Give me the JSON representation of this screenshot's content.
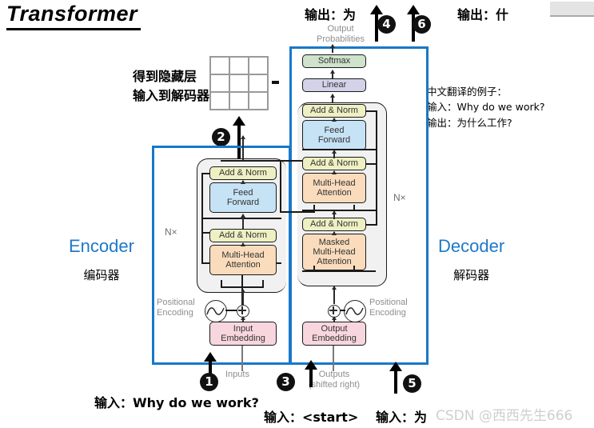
{
  "title": "Transformer",
  "labels": {
    "encoder_en": "Encoder",
    "encoder_zh": "编码器",
    "decoder_en": "Decoder",
    "decoder_zh": "解码器",
    "hidden_note_line1": "得到隐藏层",
    "hidden_note_line2": "输入到解码器",
    "nx_encoder": "N×",
    "nx_decoder": "N×"
  },
  "annotations": {
    "top_left_output": "输出：为",
    "top_right_output": "输出：什",
    "bottom_left_input": "输入：Why do we work?",
    "bottom_mid_input": "输入：<start>",
    "bottom_right_input": "输入：为",
    "badge1": "1",
    "badge2": "2",
    "badge3": "3",
    "badge4": "4",
    "badge5": "5",
    "badge6": "6"
  },
  "example_note": {
    "line1": "中文翻译的例子：",
    "line2": "输入：Why do we work?",
    "line3": "输出：为什么工作?"
  },
  "figure": {
    "output_probabilities_line1": "Output",
    "output_probabilities_line2": "Probabilities",
    "softmax": "Softmax",
    "linear": "Linear",
    "add_norm": "Add & Norm",
    "feed_forward_line1": "Feed",
    "feed_forward_line2": "Forward",
    "multi_head_attention_line1": "Multi-Head",
    "multi_head_attention_line2": "Attention",
    "masked_line1": "Masked",
    "masked_line2": "Multi-Head",
    "masked_line3": "Attention",
    "positional_encoding_line1": "Positional",
    "positional_encoding_line2": "Encoding",
    "input_embedding_line1": "Input",
    "input_embedding_line2": "Embedding",
    "output_embedding_line1": "Output",
    "output_embedding_line2": "Embedding",
    "inputs": "Inputs",
    "outputs_line1": "Outputs",
    "outputs_line2": "(shifted right)"
  },
  "watermark": "CSDN @西西先生666",
  "colors": {
    "accent_blue": "#1878c8",
    "add_norm": "#eef0c3",
    "feed_forward": "#c6e2f5",
    "attention": "#fadcbc",
    "embedding": "#f8d6de",
    "softmax": "#cfe3cc",
    "linear": "#d3d2e8"
  }
}
